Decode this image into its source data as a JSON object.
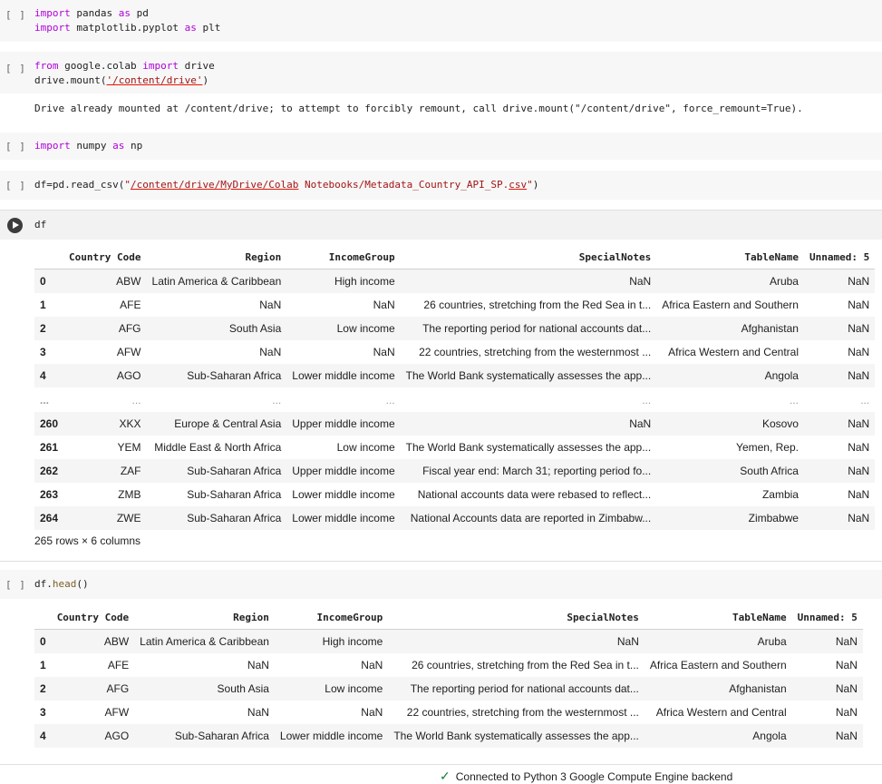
{
  "cells": [
    {
      "indicator": "[ ]",
      "code_lines": [
        "import pandas as pd",
        "import matplotlib.pyplot as plt"
      ]
    },
    {
      "indicator": "[ ]",
      "code_lines": [
        "from google.colab import drive",
        "drive.mount('/content/drive')"
      ],
      "output": "Drive already mounted at /content/drive; to attempt to forcibly remount, call drive.mount(\"/content/drive\", force_remount=True)."
    },
    {
      "indicator": "[ ]",
      "code_lines": [
        "import numpy as np"
      ]
    },
    {
      "indicator": "[ ]",
      "code_lines": [
        "df=pd.read_csv(\"/content/drive/MyDrive/Colab Notebooks/Metadata_Country_API_SP.csv\")"
      ]
    },
    {
      "indicator": "run",
      "code_lines": [
        "df"
      ]
    },
    {
      "indicator": "[ ]",
      "code_lines": [
        "df.head()"
      ]
    }
  ],
  "df_table": {
    "columns": [
      "",
      "Country Code",
      "Region",
      "IncomeGroup",
      "SpecialNotes",
      "TableName",
      "Unnamed: 5"
    ],
    "rows": [
      [
        "0",
        "ABW",
        "Latin America & Caribbean",
        "High income",
        "NaN",
        "Aruba",
        "NaN"
      ],
      [
        "1",
        "AFE",
        "NaN",
        "NaN",
        "26 countries, stretching from the Red Sea in t...",
        "Africa Eastern and Southern",
        "NaN"
      ],
      [
        "2",
        "AFG",
        "South Asia",
        "Low income",
        "The reporting period for national accounts dat...",
        "Afghanistan",
        "NaN"
      ],
      [
        "3",
        "AFW",
        "NaN",
        "NaN",
        "22 countries, stretching from the westernmost ...",
        "Africa Western and Central",
        "NaN"
      ],
      [
        "4",
        "AGO",
        "Sub-Saharan Africa",
        "Lower middle income",
        "The World Bank systematically assesses the app...",
        "Angola",
        "NaN"
      ],
      [
        "...",
        "...",
        "...",
        "...",
        "...",
        "...",
        "..."
      ],
      [
        "260",
        "XKX",
        "Europe & Central Asia",
        "Upper middle income",
        "NaN",
        "Kosovo",
        "NaN"
      ],
      [
        "261",
        "YEM",
        "Middle East & North Africa",
        "Low income",
        "The World Bank systematically assesses the app...",
        "Yemen, Rep.",
        "NaN"
      ],
      [
        "262",
        "ZAF",
        "Sub-Saharan Africa",
        "Upper middle income",
        "Fiscal year end: March 31; reporting period fo...",
        "South Africa",
        "NaN"
      ],
      [
        "263",
        "ZMB",
        "Sub-Saharan Africa",
        "Lower middle income",
        "National accounts data were rebased to reflect...",
        "Zambia",
        "NaN"
      ],
      [
        "264",
        "ZWE",
        "Sub-Saharan Africa",
        "Lower middle income",
        "National Accounts data are reported in Zimbabw...",
        "Zimbabwe",
        "NaN"
      ]
    ],
    "shape": "265 rows × 6 columns"
  },
  "head_table": {
    "columns": [
      "",
      "Country Code",
      "Region",
      "IncomeGroup",
      "SpecialNotes",
      "TableName",
      "Unnamed: 5"
    ],
    "rows": [
      [
        "0",
        "ABW",
        "Latin America & Caribbean",
        "High income",
        "NaN",
        "Aruba",
        "NaN"
      ],
      [
        "1",
        "AFE",
        "NaN",
        "NaN",
        "26 countries, stretching from the Red Sea in t...",
        "Africa Eastern and Southern",
        "NaN"
      ],
      [
        "2",
        "AFG",
        "South Asia",
        "Low income",
        "The reporting period for national accounts dat...",
        "Afghanistan",
        "NaN"
      ],
      [
        "3",
        "AFW",
        "NaN",
        "NaN",
        "22 countries, stretching from the westernmost ...",
        "Africa Western and Central",
        "NaN"
      ],
      [
        "4",
        "AGO",
        "Sub-Saharan Africa",
        "Lower middle income",
        "The World Bank systematically assesses the app...",
        "Angola",
        "NaN"
      ]
    ]
  },
  "status": {
    "icon": "check-icon",
    "text": "Connected to Python 3 Google Compute Engine backend"
  }
}
